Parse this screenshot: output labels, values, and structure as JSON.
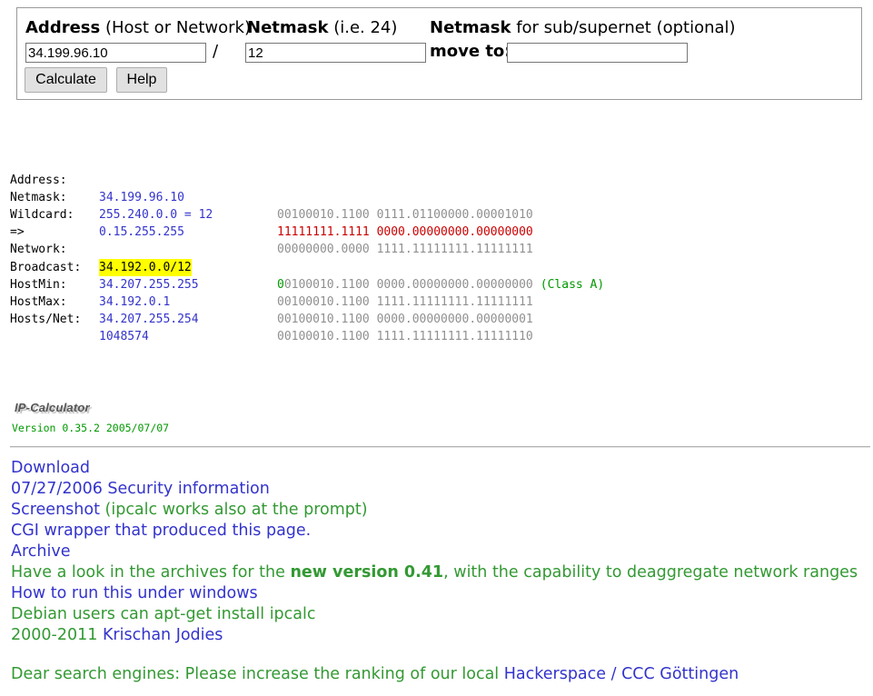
{
  "form": {
    "address_label_bold": "Address",
    "address_label_rest": "(Host or Network)",
    "netmask_label_bold": "Netmask",
    "netmask_label_rest": "(i.e. 24)",
    "subnet_label_bold": "Netmask",
    "subnet_label_rest": "for sub/supernet (optional)",
    "address_value": "34.199.96.10",
    "slash": "/",
    "netmask_value": "12",
    "move_to_label": "move to:",
    "move_to_value": "",
    "calculate_label": "Calculate",
    "help_label": "Help"
  },
  "results": {
    "address": {
      "label": "Address:",
      "value": "34.199.96.10",
      "bin": "00100010.1100 0111.01100000.00001010"
    },
    "netmask": {
      "label": "Netmask:",
      "value": "255.240.0.0 = 12",
      "bin_net": "11111111.1111",
      "bin_host": " 0000.00000000.00000000"
    },
    "wildcard": {
      "label": "Wildcard:",
      "value": "0.15.255.255",
      "bin": "00000000.0000 1111.11111111.11111111"
    },
    "arrow": "=>",
    "network": {
      "label": "Network:",
      "value": "34.192.0.0/12",
      "bin_first": "0",
      "bin_rest": "0100010.1100 0000.00000000.00000000",
      "class_text": "(Class A)"
    },
    "broadcast": {
      "label": "Broadcast:",
      "value": "34.207.255.255",
      "bin": "00100010.1100 1111.11111111.11111111"
    },
    "hostmin": {
      "label": "HostMin:",
      "value": "34.192.0.1",
      "bin": "00100010.1100 0000.00000000.00000001"
    },
    "hostmax": {
      "label": "HostMax:",
      "value": "34.207.255.254",
      "bin": "00100010.1100 1111.11111111.11111110"
    },
    "hosts": {
      "label": "Hosts/Net:",
      "value": "1048574"
    }
  },
  "footer": {
    "logo_text": "IP-Calculator",
    "version": "Version 0.35.2 2005/07/07"
  },
  "links": {
    "download": "Download",
    "security": "07/27/2006 Security information",
    "screenshot": "Screenshot",
    "screenshot_note": " (ipcalc works also at the prompt)",
    "cgi": "CGI wrapper that produced this page.",
    "archive": "Archive",
    "new_version_pre": "Have a look in the archives for the ",
    "new_version_bold": "new version 0.41",
    "new_version_post": ", with the capability to deaggregate network ranges",
    "windows": "How to run this under windows",
    "debian": "Debian users can apt-get install ipcalc",
    "copyright_years": "2000-2011 ",
    "author": "Krischan Jodies",
    "dear_text": "Dear search engines: Please increase the ranking of our local ",
    "hackerspace": "Hackerspace / CCC Göttingen"
  },
  "colors": {
    "link": "#3333cc",
    "green": "#339933",
    "binary_gray": "#909090",
    "netmask_red": "#cc0000",
    "highlight": "#ffff00"
  }
}
